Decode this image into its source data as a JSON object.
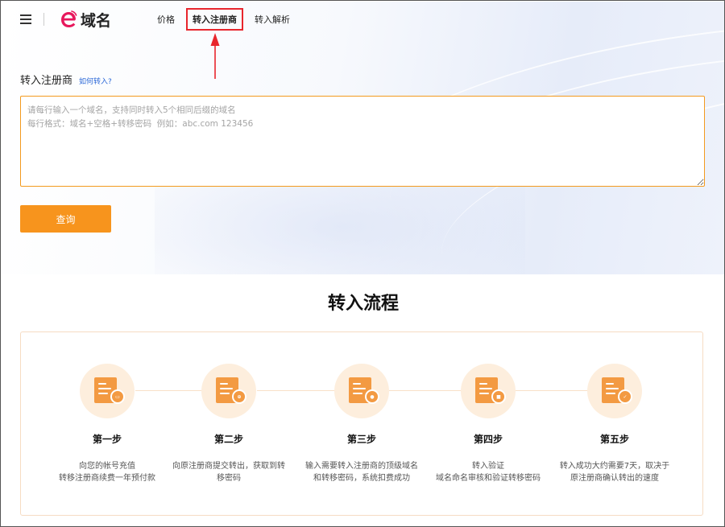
{
  "header": {
    "brand": "域名",
    "nav": [
      {
        "label": "价格",
        "active": false
      },
      {
        "label": "转入注册商",
        "active": true
      },
      {
        "label": "转入解析",
        "active": false
      }
    ]
  },
  "form": {
    "title": "转入注册商",
    "help_link": "如何转入?",
    "placeholder": "请每行输入一个域名，支持同时转入5个相同后缀的域名\n每行格式：域名+空格+转移密码  例如：abc.com 123456",
    "value": "",
    "submit_label": "查询"
  },
  "process": {
    "title": "转入流程",
    "steps": [
      {
        "name": "第一步",
        "line1": "向您的帐号充值",
        "line2": "转移注册商续费一年预付款",
        "icon": "wallet-icon"
      },
      {
        "name": "第二步",
        "line1": "向原注册商提交转出，获取到转",
        "line2": "移密码",
        "icon": "globe-icon"
      },
      {
        "name": "第三步",
        "line1": "输入需要转入注册商的顶级域名",
        "line2": "和转移密码，系统扣费成功",
        "icon": "coin-icon"
      },
      {
        "name": "第四步",
        "line1": "转入验证",
        "line2": "域名命名审核和验证转移密码",
        "icon": "lock-icon"
      },
      {
        "name": "第五步",
        "line1": "转入成功大约需要7天，取决于",
        "line2": "原注册商确认转出的速度",
        "icon": "check-icon"
      }
    ]
  },
  "colors": {
    "accent": "#f7941d",
    "highlight_box": "#e8262d",
    "link": "#2f6bd8"
  }
}
